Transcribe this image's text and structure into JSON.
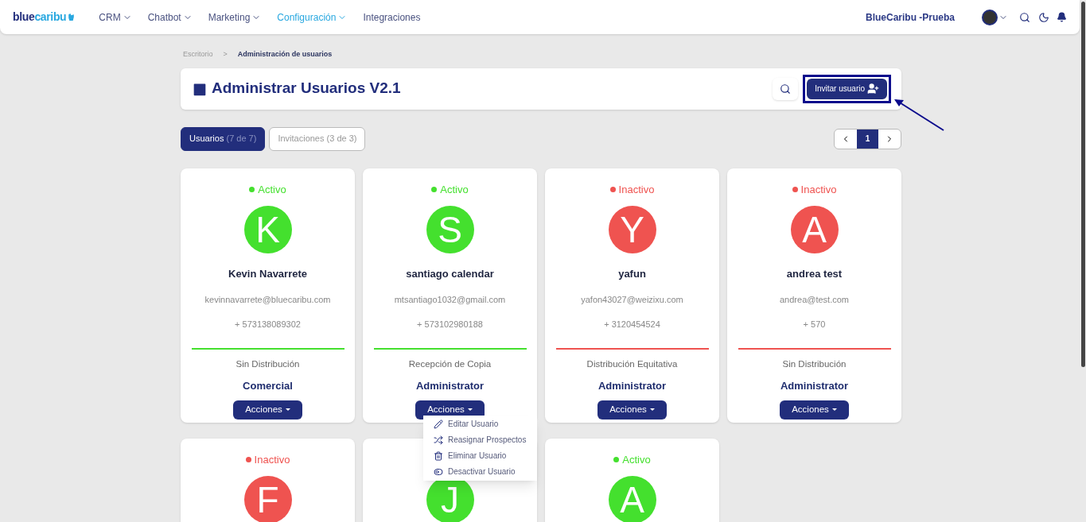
{
  "navbar": {
    "logo": {
      "part_1": "blue",
      "part_2": "caribu"
    },
    "menu": [
      {
        "label": "CRM",
        "dropdown": true,
        "selected": false
      },
      {
        "label": "Chatbot",
        "dropdown": true,
        "selected": false
      },
      {
        "label": "Marketing",
        "dropdown": true,
        "selected": false
      },
      {
        "label": "Configuración",
        "dropdown": true,
        "selected": true
      },
      {
        "label": "Integraciones",
        "dropdown": false,
        "selected": false
      }
    ],
    "account": "BlueCaribu -Prueba"
  },
  "breadcrumb": [
    "Escritorio",
    ">",
    "Administración de usuarios"
  ],
  "header": {
    "title": "Administrar Usuarios V2.1",
    "invite_button": {
      "label": "Invitar usuario",
      "highlighted": true
    }
  },
  "tabs": [
    {
      "label": "Usuarios",
      "count": "(7 de 7)",
      "selected": true
    },
    {
      "label": "Invitaciones",
      "count": "(3 de 3)",
      "selected": false
    }
  ],
  "pagination": {
    "pages": [
      {
        "label": "1",
        "selected": true
      }
    ]
  },
  "users": [
    {
      "status": "Activo",
      "active": true,
      "initial": "K",
      "name": "Kevin Navarrete",
      "email": "kevinnavarrete@bluecaribu.com",
      "phone": "+ 573138089302",
      "distribution": "Sin Distribución",
      "role": "Comercial",
      "actions": "Acciones",
      "menu_open": false
    },
    {
      "status": "Activo",
      "active": true,
      "initial": "S",
      "name": "santiago calendar",
      "email": "mtsantiago1032@gmail.com",
      "phone": "+ 573102980188",
      "distribution": "Recepción de Copia",
      "role": "Administrator",
      "actions": "Acciones",
      "menu_open": true
    },
    {
      "status": "Inactivo",
      "active": false,
      "initial": "Y",
      "name": "yafun",
      "email": "yafon43027@weizixu.com",
      "phone": "+ 3120454524",
      "distribution": "Distribución Equitativa",
      "role": "Administrator",
      "actions": "Acciones",
      "menu_open": false
    },
    {
      "status": "Inactivo",
      "active": false,
      "initial": "A",
      "name": "andrea test",
      "email": "andrea@test.com",
      "phone": "+ 570",
      "distribution": "Sin Distribución",
      "role": "Administrator",
      "actions": "Acciones",
      "menu_open": false
    },
    {
      "status": "Inactivo",
      "active": false,
      "initial": "F"
    },
    {
      "active": true,
      "initial": "J"
    },
    {
      "status": "Activo",
      "active": true,
      "initial": "A"
    }
  ],
  "actions_menu": [
    {
      "kind": "edit",
      "label": "Editar Usuario"
    },
    {
      "kind": "reassign",
      "label": "Reasignar Prospectos"
    },
    {
      "kind": "delete",
      "label": "Eliminar Usuario"
    },
    {
      "kind": "deactivate",
      "label": "Desactivar Usuario"
    }
  ]
}
